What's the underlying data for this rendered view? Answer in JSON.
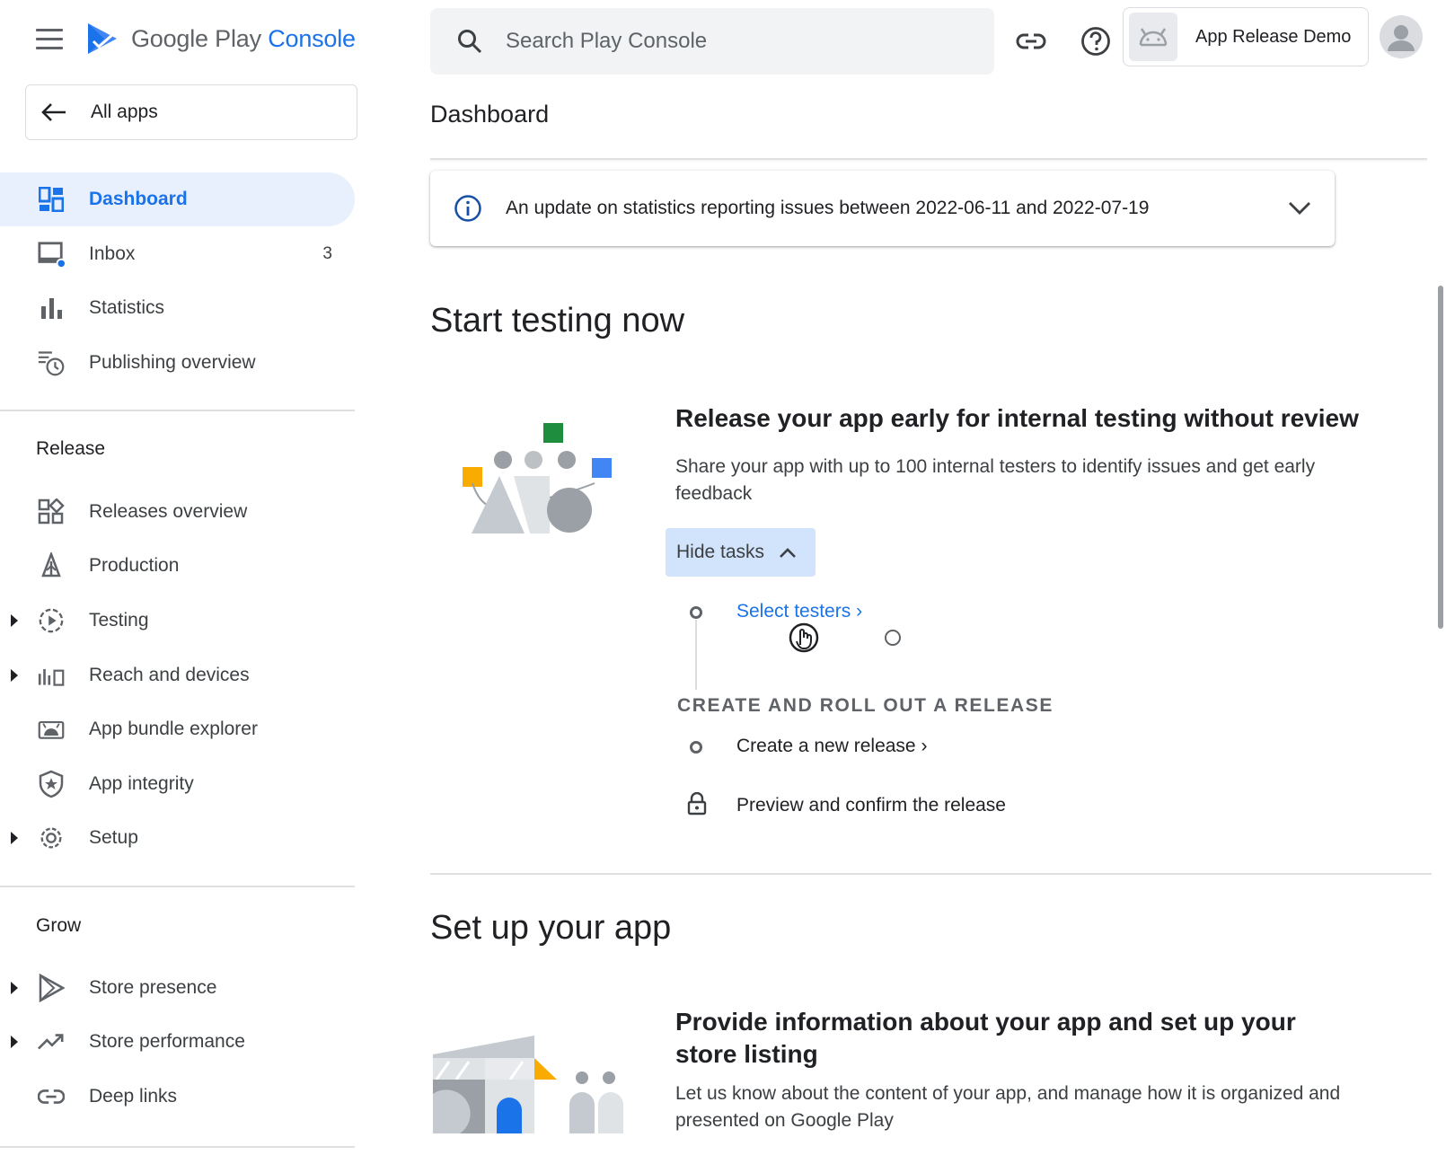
{
  "brand": {
    "google_play": "Google Play",
    "console": "Console"
  },
  "sidebar": {
    "all_apps": "All apps",
    "top_items": [
      {
        "label": "Dashboard",
        "icon": "dashboard-icon"
      },
      {
        "label": "Inbox",
        "icon": "inbox-icon",
        "count": "3"
      },
      {
        "label": "Statistics",
        "icon": "bar-chart-icon"
      },
      {
        "label": "Publishing overview",
        "icon": "publishing-icon"
      }
    ],
    "release_title": "Release",
    "release_items": [
      {
        "label": "Releases overview",
        "icon": "releases-icon"
      },
      {
        "label": "Production",
        "icon": "rocket-icon"
      },
      {
        "label": "Testing",
        "icon": "testing-icon"
      },
      {
        "label": "Reach and devices",
        "icon": "reach-icon"
      },
      {
        "label": "App bundle explorer",
        "icon": "android-box-icon"
      },
      {
        "label": "App integrity",
        "icon": "shield-icon"
      },
      {
        "label": "Setup",
        "icon": "gear-icon"
      }
    ],
    "grow_title": "Grow",
    "grow_items": [
      {
        "label": "Store presence",
        "icon": "play-icon"
      },
      {
        "label": "Store performance",
        "icon": "trending-icon"
      },
      {
        "label": "Deep links",
        "icon": "link-icon"
      }
    ]
  },
  "topbar": {
    "search_placeholder": "Search Play Console",
    "app_name": "App Release Demo"
  },
  "main": {
    "title": "Dashboard",
    "banner": "An update on statistics reporting issues between 2022-06-11 and 2022-07-19",
    "testing": {
      "heading": "Start testing now",
      "card_title": "Release your app early for internal testing without review",
      "card_desc": "Share your app with up to 100 internal testers to identify issues and get early feedback",
      "hide_tasks": "Hide tasks",
      "task_select": "Select testers",
      "section_heading": "CREATE AND ROLL OUT A RELEASE",
      "task_create": "Create a new release",
      "task_preview": "Preview and confirm the release"
    },
    "setup": {
      "heading": "Set up your app",
      "card_title": "Provide information about your app and set up your store listing",
      "card_desc": "Let us know about the content of your app, and manage how it is organized and presented on Google Play"
    }
  },
  "colors": {
    "accent": "#1a73e8",
    "active_bg": "#e8f0fe",
    "chip_bg": "#d2e3fc"
  }
}
